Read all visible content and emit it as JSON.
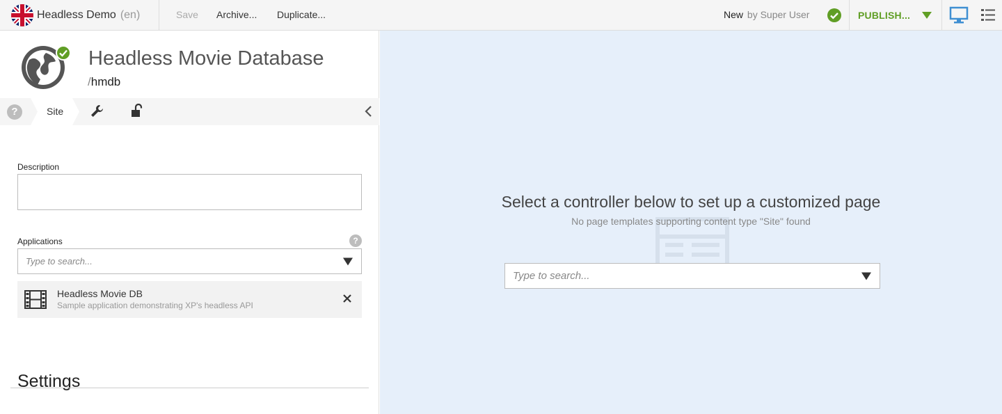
{
  "toolbar": {
    "project_name": "Headless Demo",
    "project_lang": "(en)",
    "save_label": "Save",
    "archive_label": "Archive...",
    "duplicate_label": "Duplicate...",
    "status_state": "New",
    "status_by": "by Super User",
    "publish_label": "PUBLISH...",
    "accent_color": "#609e25"
  },
  "content": {
    "display_name": "Headless Movie Database",
    "path_slash": "/",
    "path_name": "hmdb"
  },
  "tabs": {
    "help": "?",
    "site": "Site",
    "icons": [
      "wrench-icon",
      "unlock-icon",
      "chevron-left-icon"
    ]
  },
  "form": {
    "description_label": "Description",
    "description_value": "",
    "applications_label": "Applications",
    "applications_help": "?",
    "applications_placeholder": "Type to search...",
    "applications": [
      {
        "name": "Headless Movie DB",
        "description": "Sample application demonstrating XP's headless API",
        "icon": "film-icon"
      }
    ],
    "settings_heading": "Settings"
  },
  "live_view": {
    "title": "Select a controller below to set up a customized page",
    "subtitle": "No page templates supporting content type \"Site\" found",
    "controller_placeholder": "Type to search...",
    "background_color": "#e6effa"
  }
}
